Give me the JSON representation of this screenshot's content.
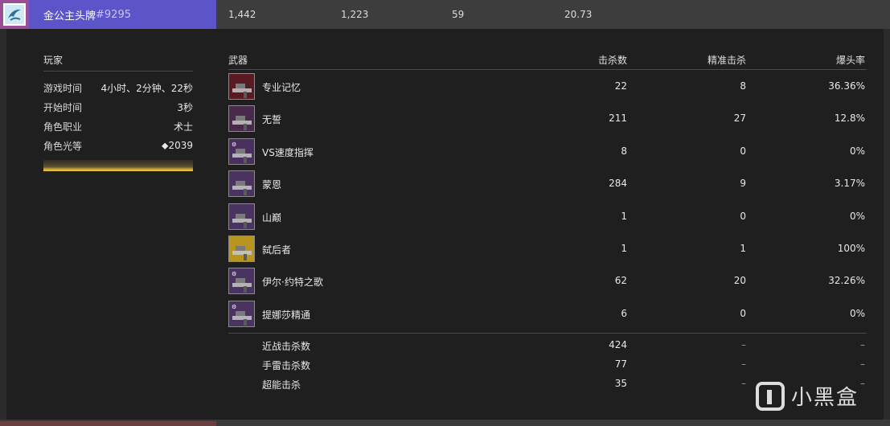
{
  "header": {
    "player_name": "金公主头牌",
    "player_code": "#9295",
    "stats": [
      "1,442",
      "1,223",
      "59",
      "20.73"
    ]
  },
  "player": {
    "heading": "玩家",
    "rows": [
      {
        "label": "游戏时间",
        "value": "4小时、2分钟、22秒"
      },
      {
        "label": "开始时间",
        "value": "3秒"
      },
      {
        "label": "角色职业",
        "value": "术士"
      },
      {
        "label": "角色光等",
        "value": "⬥2039"
      }
    ],
    "light_bar_color": "#f0c848"
  },
  "weapons": {
    "headers": {
      "name": "武器",
      "kills": "击杀数",
      "precision": "精准击杀",
      "ratio": "爆头率"
    },
    "rows": [
      {
        "name": "专业记忆",
        "kills": "22",
        "precision": "8",
        "ratio": "36.36%",
        "icon": "sniper-rifle-icon",
        "icon_bg": "#5a1a22",
        "badge": ""
      },
      {
        "name": "无誓",
        "kills": "211",
        "precision": "27",
        "ratio": "12.8%",
        "icon": "bow-icon",
        "icon_bg": "#4a2a4a",
        "badge": ""
      },
      {
        "name": "VS速度指挥",
        "kills": "8",
        "precision": "0",
        "ratio": "0%",
        "icon": "pulse-rifle-icon",
        "icon_bg": "#4b2f5e",
        "badge": "⚙"
      },
      {
        "name": "蒙恩",
        "kills": "284",
        "precision": "9",
        "ratio": "3.17%",
        "icon": "smg-icon",
        "icon_bg": "#4a3360",
        "badge": ""
      },
      {
        "name": "山巅",
        "kills": "1",
        "precision": "0",
        "ratio": "0%",
        "icon": "scout-rifle-icon",
        "icon_bg": "#4a3360",
        "badge": ""
      },
      {
        "name": "弑后者",
        "kills": "1",
        "precision": "1",
        "ratio": "100%",
        "icon": "exotic-rifle-icon",
        "icon_bg": "#b8961e",
        "badge": ""
      },
      {
        "name": "伊尔·约特之歌",
        "kills": "62",
        "precision": "20",
        "ratio": "32.26%",
        "icon": "heavy-weapon-icon",
        "icon_bg": "#4a3360",
        "badge": "⚙"
      },
      {
        "name": "提娜莎精通",
        "kills": "6",
        "precision": "0",
        "ratio": "0%",
        "icon": "sidearm-icon",
        "icon_bg": "#4a3360",
        "badge": "⚙"
      }
    ],
    "misc": [
      {
        "name": "近战击杀数",
        "kills": "424",
        "precision": "–",
        "ratio": "–"
      },
      {
        "name": "手雷击杀数",
        "kills": "77",
        "precision": "–",
        "ratio": "–"
      },
      {
        "name": "超能击杀",
        "kills": "35",
        "precision": "–",
        "ratio": "–"
      }
    ]
  },
  "watermark": {
    "text": "小黑盒"
  }
}
